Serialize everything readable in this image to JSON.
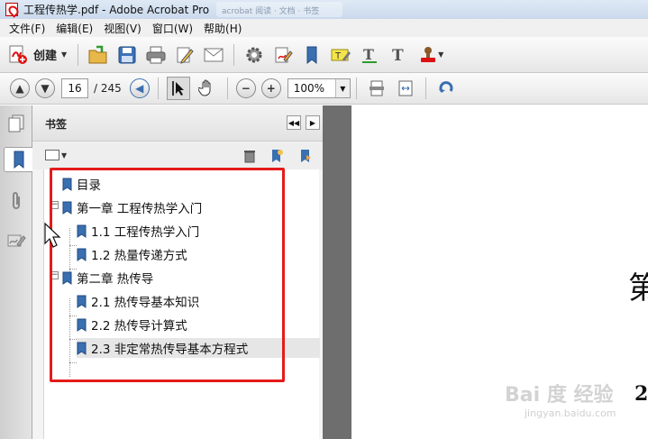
{
  "window": {
    "title": "工程传热学.pdf - Adobe Acrobat Pro",
    "background_tab": "acrobat 阅读 · 文档 · 书签"
  },
  "menu": [
    "文件(F)",
    "编辑(E)",
    "视图(V)",
    "窗口(W)",
    "帮助(H)"
  ],
  "toolbar": {
    "create_label": "创建",
    "icons": [
      "open-folder-icon",
      "save-icon",
      "print-icon",
      "edit-icon",
      "email-icon",
      "settings-icon",
      "sign-icon",
      "bookmark-add-icon",
      "highlight-icon",
      "text-underline-icon",
      "text-icon",
      "stamp-icon"
    ]
  },
  "nav": {
    "page_current": "16",
    "page_total": "/ 245",
    "zoom": "100%"
  },
  "panel": {
    "title": "书签"
  },
  "bookmarks": [
    {
      "label": "目录",
      "level": 0,
      "expandable": false
    },
    {
      "label": "第一章 工程传热学入门",
      "level": 0,
      "expandable": true
    },
    {
      "label": "1.1 工程传热学入门",
      "level": 1,
      "expandable": false
    },
    {
      "label": "1.2 热量传递方式",
      "level": 1,
      "expandable": false
    },
    {
      "label": "第二章 热传导",
      "level": 0,
      "expandable": true
    },
    {
      "label": "2.1 热传导基本知识",
      "level": 1,
      "expandable": false
    },
    {
      "label": "2.2 热传导计算式",
      "level": 1,
      "expandable": false
    },
    {
      "label": "2.3 非定常热传导基本方程式",
      "level": 1,
      "expandable": false,
      "selected": true
    }
  ],
  "document": {
    "text1": "第",
    "text2": "2"
  },
  "watermark": {
    "main": "Bai 度 经验",
    "sub": "jingyan.baidu.com"
  },
  "colors": {
    "highlight_box": "#e41b1b",
    "bookmark_icon": "#3a6fb0"
  }
}
